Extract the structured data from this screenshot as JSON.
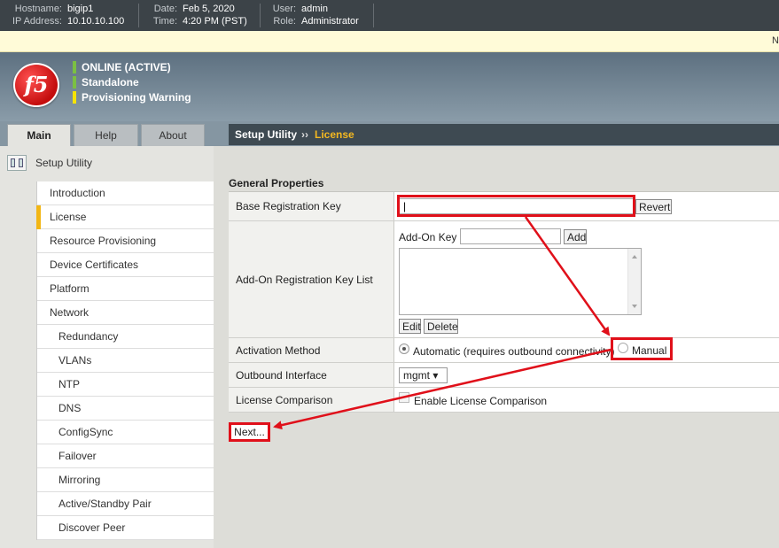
{
  "topbar": {
    "hostname_label": "Hostname:",
    "hostname": "bigip1",
    "ip_label": "IP Address:",
    "ip": "10.10.10.100",
    "date_label": "Date:",
    "date": "Feb 5, 2020",
    "time_label": "Time:",
    "time": "4:20 PM (PST)",
    "user_label": "User:",
    "user": "admin",
    "role_label": "Role:",
    "role": "Administrator"
  },
  "notice": {
    "text": "N"
  },
  "logo": {
    "text": "f5"
  },
  "status": [
    {
      "text": "ONLINE (ACTIVE)",
      "color": "#7bc043"
    },
    {
      "text": "Standalone",
      "color": "#7bc043"
    },
    {
      "text": "Provisioning Warning",
      "color": "#f7e400"
    }
  ],
  "tabs": [
    "Main",
    "Help",
    "About"
  ],
  "breadcrumb": {
    "root": "Setup Utility",
    "sep": "››",
    "current": "License"
  },
  "nav": {
    "header": "Setup Utility",
    "items": [
      "Introduction",
      "License",
      "Resource Provisioning",
      "Device Certificates",
      "Platform",
      "Network",
      "Redundancy",
      "VLANs",
      "NTP",
      "DNS",
      "ConfigSync",
      "Failover",
      "Mirroring",
      "Active/Standby Pair",
      "Discover Peer"
    ]
  },
  "form": {
    "section_title": "General Properties",
    "base_key_label": "Base Registration Key",
    "base_key_value": "|",
    "revert_label": "Revert",
    "addon_label": "Add-On Registration Key List",
    "addon_key_label": "Add-On Key",
    "add_label": "Add",
    "edit_label": "Edit",
    "delete_label": "Delete",
    "activation_label": "Activation Method",
    "automatic_label": "Automatic (requires outbound connectivity)",
    "manual_label": "Manual",
    "outbound_label": "Outbound Interface",
    "outbound_value": "mgmt ▾",
    "comparison_label": "License Comparison",
    "comparison_option": "Enable License Comparison",
    "next_label": "Next..."
  },
  "colors": {
    "annotation": "#e0101a",
    "active_accent": "#f2b615",
    "breadcrumb_current": "#f4b820"
  }
}
